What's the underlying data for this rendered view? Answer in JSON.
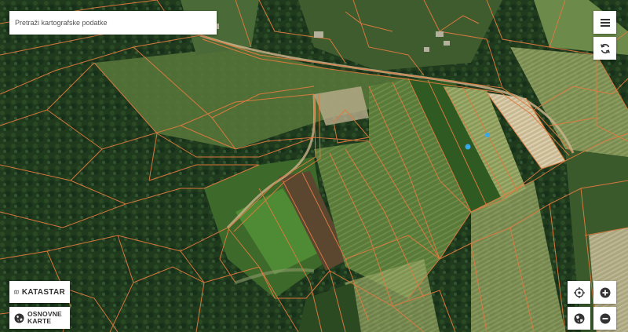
{
  "search": {
    "placeholder": "Pretraži kartografske podatke"
  },
  "controls": {
    "menu_icon": "hamburger-menu-icon",
    "refresh_icon": "refresh-arrows-icon",
    "locate_icon": "crosshair-icon",
    "zoom_in_icon": "plus-icon",
    "globe_icon": "globe-icon",
    "zoom_out_icon": "minus-icon"
  },
  "layers": {
    "cadastre_label": "KATASTAR",
    "cadastre_icon": "folded-map-icon",
    "basemaps_label_line1": "OSNOVNE",
    "basemaps_label_line2": "KARTE",
    "basemaps_icon": "layers-globe-icon"
  },
  "map": {
    "imagery": "satellite",
    "parcel_line_color": "#e07a3f",
    "location_marker_color": "#38a9e8"
  }
}
